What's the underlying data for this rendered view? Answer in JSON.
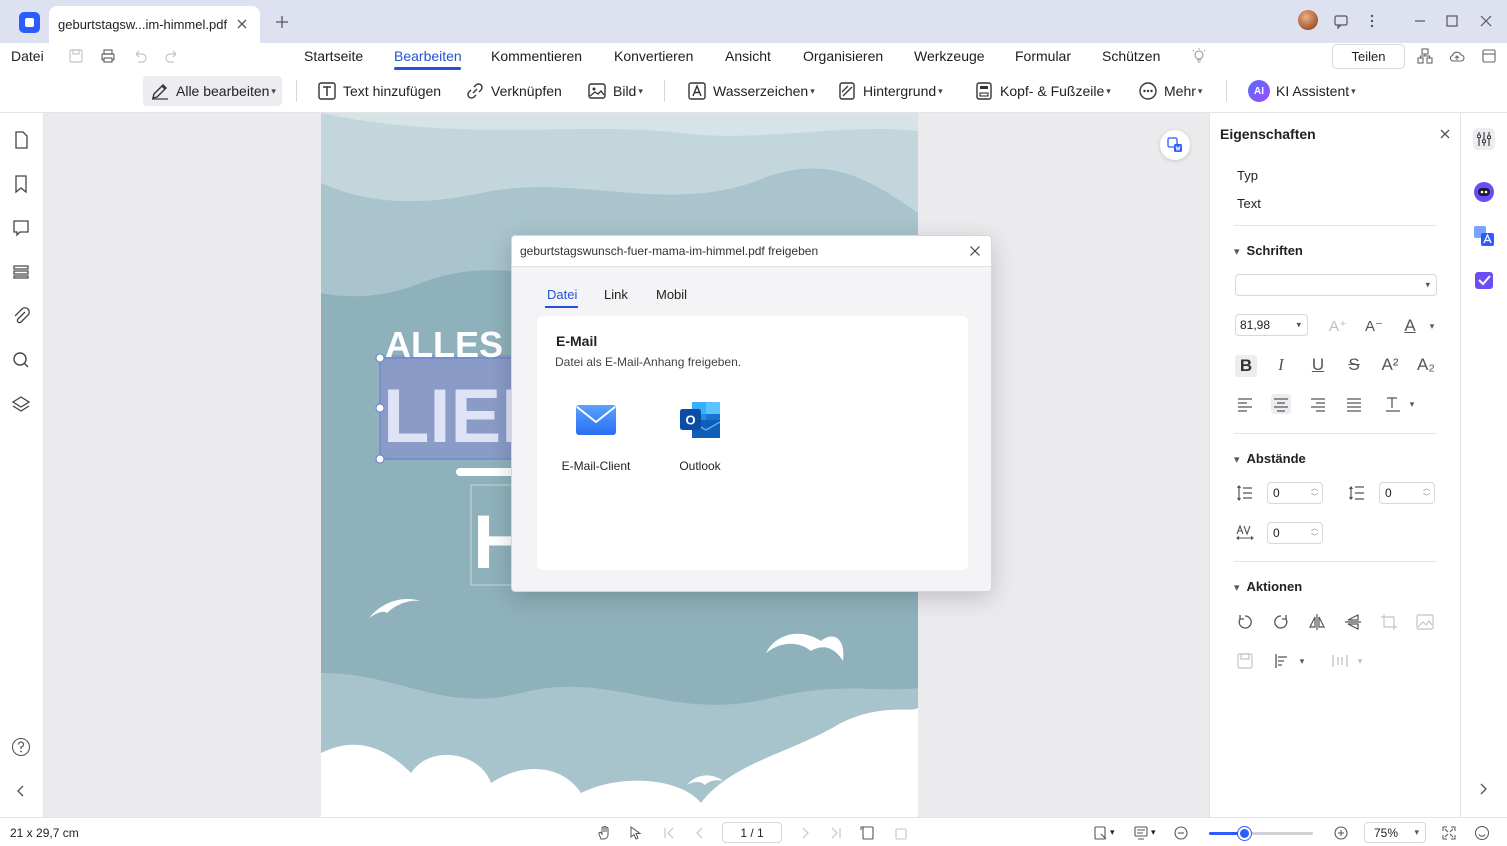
{
  "titlebar": {
    "tab_title": "geburtstagsw...im-himmel.pdf"
  },
  "menubar": {
    "datei": "Datei",
    "items": [
      {
        "label": "Startseite",
        "active": false
      },
      {
        "label": "Bearbeiten",
        "active": true
      },
      {
        "label": "Kommentieren",
        "active": false
      },
      {
        "label": "Konvertieren",
        "active": false
      },
      {
        "label": "Ansicht",
        "active": false
      },
      {
        "label": "Organisieren",
        "active": false
      },
      {
        "label": "Werkzeuge",
        "active": false
      },
      {
        "label": "Formular",
        "active": false
      },
      {
        "label": "Schützen",
        "active": false
      }
    ],
    "share_label": "Teilen"
  },
  "toolbar": {
    "edit_all": "Alle bearbeiten",
    "add_text": "Text hinzufügen",
    "link": "Verknüpfen",
    "image": "Bild",
    "watermark": "Wasserzeichen",
    "background": "Hintergrund",
    "header_footer": "Kopf- & Fußzeile",
    "more": "Mehr",
    "ai_badge": "AI",
    "ai_assistant": "KI Assistent"
  },
  "document": {
    "line1": "ALLES G",
    "line2": "LIEB",
    "line3": "H"
  },
  "properties": {
    "title": "Eigenschaften",
    "type_label": "Typ",
    "type_value": "Text",
    "fonts_section": "Schriften",
    "font_name": "",
    "font_size": "81,98",
    "spacing_section": "Abstände",
    "line_spacing": "0",
    "paragraph_spacing": "0",
    "char_spacing": "0",
    "actions_section": "Aktionen"
  },
  "statusbar": {
    "page_size": "21 x 29,7 cm",
    "page_indicator": "1 / 1",
    "zoom": "75%",
    "zoom_fraction": 0.35
  },
  "share_dialog": {
    "title": "geburtstagswunsch-fuer-mama-im-himmel.pdf freigeben",
    "tabs": [
      {
        "label": "Datei",
        "active": true
      },
      {
        "label": "Link",
        "active": false
      },
      {
        "label": "Mobil",
        "active": false
      }
    ],
    "section_title": "E-Mail",
    "section_subtitle": "Datei als E-Mail-Anhang freigeben.",
    "options": [
      {
        "label": "E-Mail-Client",
        "icon": "mail-envelope-icon"
      },
      {
        "label": "Outlook",
        "icon": "outlook-icon"
      }
    ]
  },
  "colors": {
    "accent": "#2452d6",
    "brand": "#2a5cff",
    "page_sky": "#8fb1bc"
  }
}
